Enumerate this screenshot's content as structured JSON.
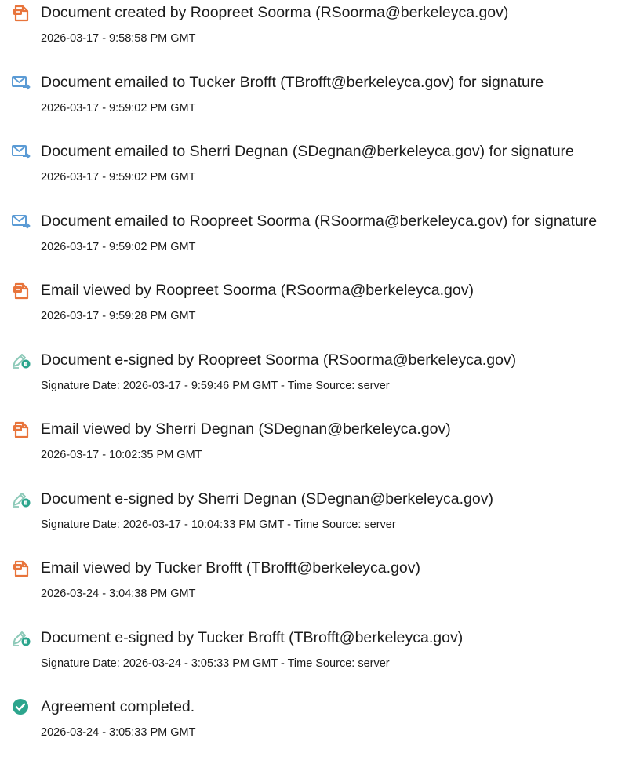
{
  "colors": {
    "doc_icon": "#e8743b",
    "email_icon": "#5b9bd5",
    "sign_icon_pen": "#8cc9b8",
    "sign_icon_badge": "#2ca58d",
    "complete_icon": "#2ca58d",
    "text": "#1c1c1c"
  },
  "events": [
    {
      "icon": "document-icon",
      "text": "Document created by Roopreet Soorma (RSoorma@berkeleyca.gov)",
      "time": "2026-03-17 - 9:58:58 PM GMT"
    },
    {
      "icon": "email-icon",
      "text": "Document emailed to Tucker Brofft (TBrofft@berkeleyca.gov) for signature",
      "time": "2026-03-17 - 9:59:02 PM GMT"
    },
    {
      "icon": "email-icon",
      "text": "Document emailed to Sherri Degnan (SDegnan@berkeleyca.gov) for signature",
      "time": "2026-03-17 - 9:59:02 PM GMT"
    },
    {
      "icon": "email-icon",
      "text": "Document emailed to Roopreet Soorma (RSoorma@berkeleyca.gov) for signature",
      "time": "2026-03-17 - 9:59:02 PM GMT"
    },
    {
      "icon": "document-icon",
      "text": "Email viewed by Roopreet Soorma (RSoorma@berkeleyca.gov)",
      "time": "2026-03-17 - 9:59:28 PM GMT"
    },
    {
      "icon": "e-sign-icon",
      "text": "Document e-signed by Roopreet Soorma (RSoorma@berkeleyca.gov)",
      "time": "Signature Date: 2026-03-17 - 9:59:46 PM GMT - Time Source: server"
    },
    {
      "icon": "document-icon",
      "text": "Email viewed by Sherri Degnan (SDegnan@berkeleyca.gov)",
      "time": "2026-03-17 - 10:02:35 PM GMT"
    },
    {
      "icon": "e-sign-icon",
      "text": "Document e-signed by Sherri Degnan (SDegnan@berkeleyca.gov)",
      "time": "Signature Date: 2026-03-17 - 10:04:33 PM GMT - Time Source: server"
    },
    {
      "icon": "document-icon",
      "text": "Email viewed by Tucker Brofft (TBrofft@berkeleyca.gov)",
      "time": "2026-03-24 - 3:04:38 PM GMT"
    },
    {
      "icon": "e-sign-icon",
      "text": "Document e-signed by Tucker Brofft (TBrofft@berkeleyca.gov)",
      "time": "Signature Date: 2026-03-24 - 3:05:33 PM GMT - Time Source: server"
    },
    {
      "icon": "checkmark-circle-icon",
      "text": "Agreement completed.",
      "time": "2026-03-24 - 3:05:33 PM GMT"
    }
  ]
}
